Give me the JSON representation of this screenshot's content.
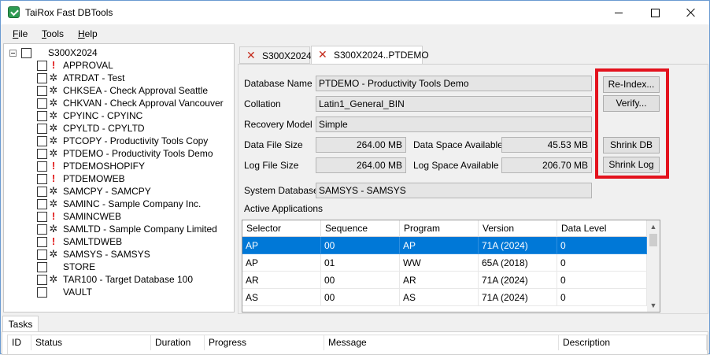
{
  "window": {
    "title": "TaiRox Fast DBTools"
  },
  "menu": [
    {
      "label": "File"
    },
    {
      "label": "Tools"
    },
    {
      "label": "Help"
    }
  ],
  "tree": {
    "root": "S300X2024",
    "items": [
      {
        "label": "APPROVAL",
        "icon": "warning"
      },
      {
        "label": "ATRDAT - Test",
        "icon": "gear"
      },
      {
        "label": "CHKSEA - Check Approval Seattle",
        "icon": "gear"
      },
      {
        "label": "CHKVAN - Check Approval Vancouver",
        "icon": "gear"
      },
      {
        "label": "CPYINC - CPYINC",
        "icon": "gear"
      },
      {
        "label": "CPYLTD - CPYLTD",
        "icon": "gear"
      },
      {
        "label": "PTCOPY - Productivity Tools Copy",
        "icon": "gear"
      },
      {
        "label": "PTDEMO - Productivity Tools Demo",
        "icon": "gear"
      },
      {
        "label": "PTDEMOSHOPIFY",
        "icon": "warning"
      },
      {
        "label": "PTDEMOWEB",
        "icon": "warning"
      },
      {
        "label": "SAMCPY - SAMCPY",
        "icon": "gear"
      },
      {
        "label": "SAMINC - Sample Company Inc.",
        "icon": "gear"
      },
      {
        "label": "SAMINCWEB",
        "icon": "warning"
      },
      {
        "label": "SAMLTD - Sample Company Limited",
        "icon": "gear"
      },
      {
        "label": "SAMLTDWEB",
        "icon": "warning"
      },
      {
        "label": "SAMSYS - SAMSYS",
        "icon": "gear"
      },
      {
        "label": "STORE",
        "icon": "none"
      },
      {
        "label": "TAR100 - Target Database 100",
        "icon": "gear"
      },
      {
        "label": "VAULT",
        "icon": "none"
      }
    ]
  },
  "tabs": [
    {
      "label": "S300X2024"
    },
    {
      "label": "S300X2024..PTDEMO"
    }
  ],
  "details": {
    "database_name_label": "Database Name",
    "database_name": "PTDEMO - Productivity Tools Demo",
    "collation_label": "Collation",
    "collation": "Latin1_General_BIN",
    "recovery_model_label": "Recovery Model",
    "recovery_model": "Simple",
    "data_file_size_label": "Data File Size",
    "data_file_size": "264.00  MB",
    "data_space_available_label": "Data Space Available",
    "data_space_available": "45.53  MB",
    "log_file_size_label": "Log File Size",
    "log_file_size": "264.00  MB",
    "log_space_available_label": "Log Space Available",
    "log_space_available": "206.70  MB",
    "system_database_label": "System Database",
    "system_database": "SAMSYS - SAMSYS",
    "active_applications_label": "Active Applications"
  },
  "buttons": {
    "reindex": "Re-Index...",
    "verify": "Verify...",
    "shrink_db": "Shrink DB",
    "shrink_log": "Shrink Log"
  },
  "apps_table": {
    "columns": [
      "Selector",
      "Sequence",
      "Program",
      "Version",
      "Data Level"
    ],
    "rows": [
      [
        "AP",
        "00",
        "AP",
        "71A (2024)",
        "0"
      ],
      [
        "AP",
        "01",
        "WW",
        "65A (2018)",
        "0"
      ],
      [
        "AR",
        "00",
        "AR",
        "71A (2024)",
        "0"
      ],
      [
        "AS",
        "00",
        "AS",
        "71A (2024)",
        "0"
      ]
    ]
  },
  "tasks": {
    "tab_label": "Tasks",
    "columns": [
      "ID",
      "Status",
      "Duration",
      "Progress",
      "Message",
      "Description"
    ]
  },
  "colors": {
    "accent": "#0078d7",
    "highlight_box": "#e3121d",
    "warning_icon": "#e01515",
    "tab_close": "#c42b1c"
  }
}
